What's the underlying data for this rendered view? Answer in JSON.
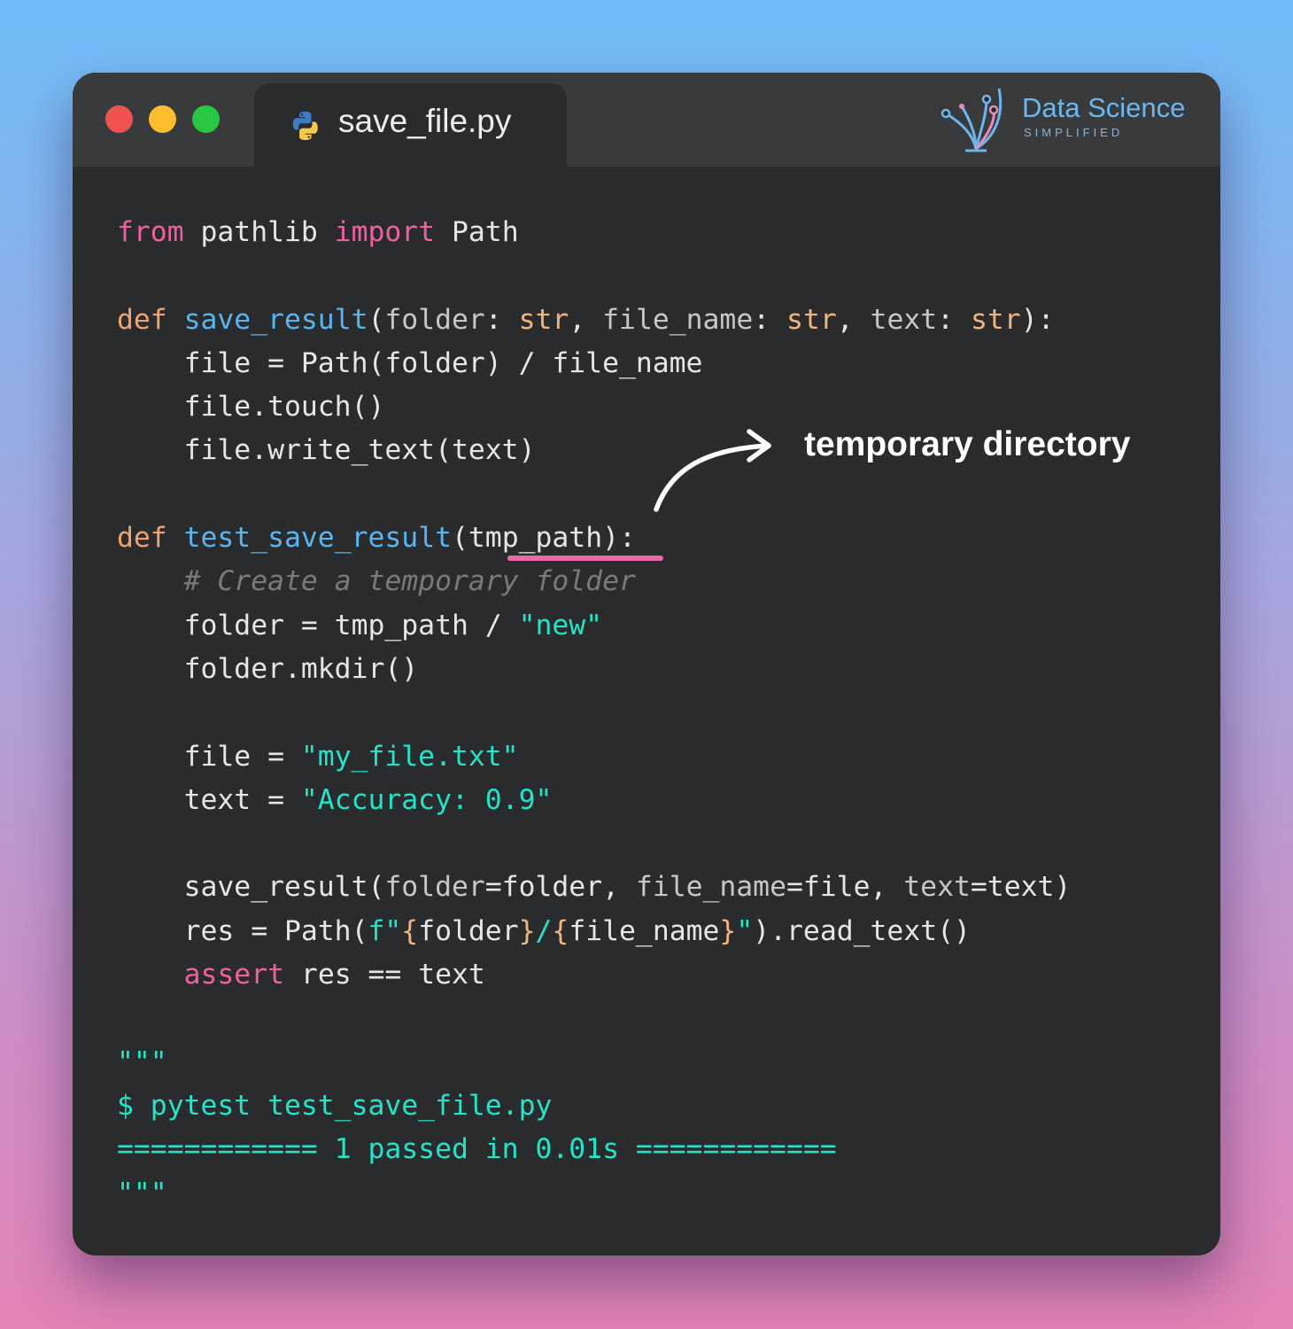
{
  "tab": {
    "file_name": "save_file.py",
    "icon": "python-icon"
  },
  "logo": {
    "title": "Data Science",
    "subtitle": "SIMPLIFIED",
    "icon": "data-science-simplified-logo"
  },
  "window_controls": {
    "close_color": "#ef5350",
    "minimize_color": "#fbbd2e",
    "maximize_color": "#28c840"
  },
  "annotation": {
    "text": "temporary directory",
    "underline_color": "#e86aa6"
  },
  "code_lines": [
    [
      [
        "keyword",
        "from"
      ],
      [
        "plain",
        " pathlib "
      ],
      [
        "keyword",
        "import"
      ],
      [
        "plain",
        " Path"
      ]
    ],
    [],
    [
      [
        "def",
        "def"
      ],
      [
        "plain",
        " "
      ],
      [
        "func",
        "save_result"
      ],
      [
        "plain",
        "("
      ],
      [
        "param",
        "folder"
      ],
      [
        "plain",
        ": "
      ],
      [
        "type",
        "str"
      ],
      [
        "plain",
        ", "
      ],
      [
        "param",
        "file_name"
      ],
      [
        "plain",
        ": "
      ],
      [
        "type",
        "str"
      ],
      [
        "plain",
        ", "
      ],
      [
        "param",
        "text"
      ],
      [
        "plain",
        ": "
      ],
      [
        "type",
        "str"
      ],
      [
        "plain",
        "):"
      ]
    ],
    [
      [
        "plain",
        "    file = Path(folder) / file_name"
      ]
    ],
    [
      [
        "plain",
        "    file.touch()"
      ]
    ],
    [
      [
        "plain",
        "    file.write_text(text)"
      ]
    ],
    [],
    [
      [
        "def",
        "def"
      ],
      [
        "plain",
        " "
      ],
      [
        "func",
        "test_save_result"
      ],
      [
        "plain",
        "(tmp_path):"
      ]
    ],
    [
      [
        "plain",
        "    "
      ],
      [
        "comment",
        "# Create a temporary folder"
      ]
    ],
    [
      [
        "plain",
        "    folder = tmp_path / "
      ],
      [
        "string",
        "\"new\""
      ]
    ],
    [
      [
        "plain",
        "    folder.mkdir()"
      ]
    ],
    [],
    [
      [
        "plain",
        "    file = "
      ],
      [
        "string",
        "\"my_file.txt\""
      ]
    ],
    [
      [
        "plain",
        "    text = "
      ],
      [
        "string",
        "\"Accuracy: 0.9\""
      ]
    ],
    [],
    [
      [
        "plain",
        "    save_result("
      ],
      [
        "param",
        "folder"
      ],
      [
        "plain",
        "=folder, "
      ],
      [
        "param",
        "file_name"
      ],
      [
        "plain",
        "=file, "
      ],
      [
        "param",
        "text"
      ],
      [
        "plain",
        "=text)"
      ]
    ],
    [
      [
        "plain",
        "    res = Path("
      ],
      [
        "string",
        "f\""
      ],
      [
        "brace",
        "{"
      ],
      [
        "plain",
        "folder"
      ],
      [
        "brace",
        "}"
      ],
      [
        "string",
        "/"
      ],
      [
        "brace",
        "{"
      ],
      [
        "plain",
        "file_name"
      ],
      [
        "brace",
        "}"
      ],
      [
        "string",
        "\""
      ],
      [
        "plain",
        ").read_text()"
      ]
    ],
    [
      [
        "plain",
        "    "
      ],
      [
        "keyword",
        "assert"
      ],
      [
        "plain",
        " res == text"
      ]
    ],
    [],
    [
      [
        "string",
        "\"\"\""
      ]
    ],
    [
      [
        "string",
        "$ pytest test_save_file.py"
      ]
    ],
    [
      [
        "string",
        "============ 1 passed in 0.01s ============"
      ]
    ],
    [
      [
        "string",
        "\"\"\""
      ]
    ]
  ]
}
